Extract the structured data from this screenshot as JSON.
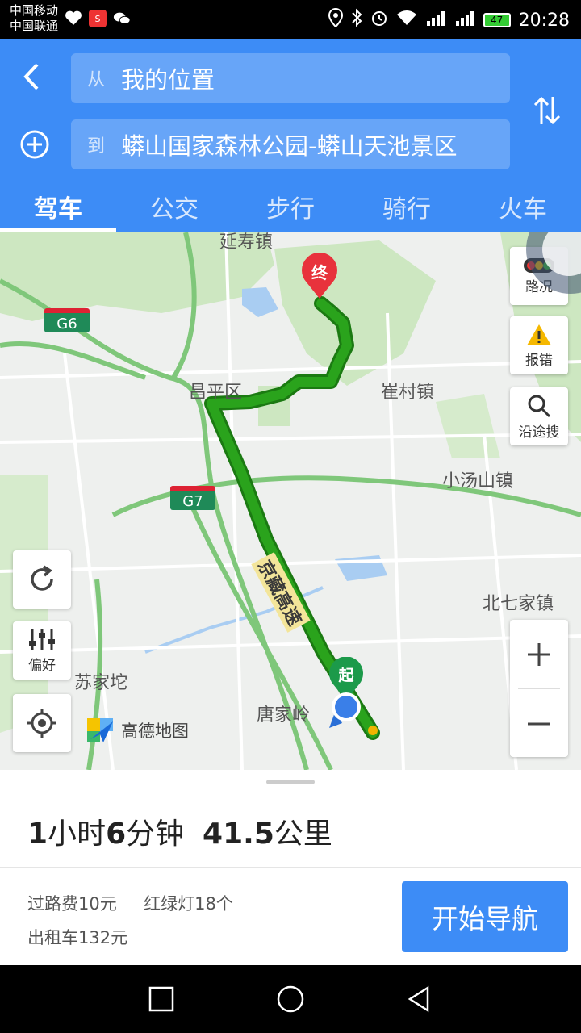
{
  "status_bar": {
    "carrier1": "中国移动",
    "carrier2": "中国联通",
    "battery": "47",
    "time": "20:28"
  },
  "header": {
    "from_tag": "从",
    "from_value": "我的位置",
    "to_tag": "到",
    "to_value": "蟒山国家森林公园-蟒山天池景区",
    "tabs": [
      {
        "label": "驾车",
        "active": true
      },
      {
        "label": "公交",
        "active": false
      },
      {
        "label": "步行",
        "active": false
      },
      {
        "label": "骑行",
        "active": false
      },
      {
        "label": "火车",
        "active": false
      }
    ]
  },
  "map": {
    "labels": {
      "yanshou": "延寿镇",
      "changping": "昌平区",
      "cuicun": "崔村镇",
      "xiaotangshan": "小汤山镇",
      "beiqijia": "北七家镇",
      "sujiatuo": "苏家坨",
      "tangjialing": "唐家岭",
      "highway": "京藏高速"
    },
    "shields": {
      "g6": "G6",
      "g7": "G7"
    },
    "markers": {
      "end": "终",
      "start": "起"
    },
    "buttons": {
      "traffic": "路况",
      "report": "报错",
      "search_along": "沿途搜",
      "preference": "偏好"
    },
    "logo": "高德地图",
    "route_color": "#2aa31c"
  },
  "panel": {
    "summary_hours": "1",
    "summary_h_unit": "小时",
    "summary_minutes": "6",
    "summary_m_unit": "分钟",
    "summary_distance": "41.5",
    "summary_d_unit": "公里",
    "toll": "过路费10元",
    "lights": "红绿灯18个",
    "taxi": "出租车132元",
    "start_button": "开始导航"
  }
}
